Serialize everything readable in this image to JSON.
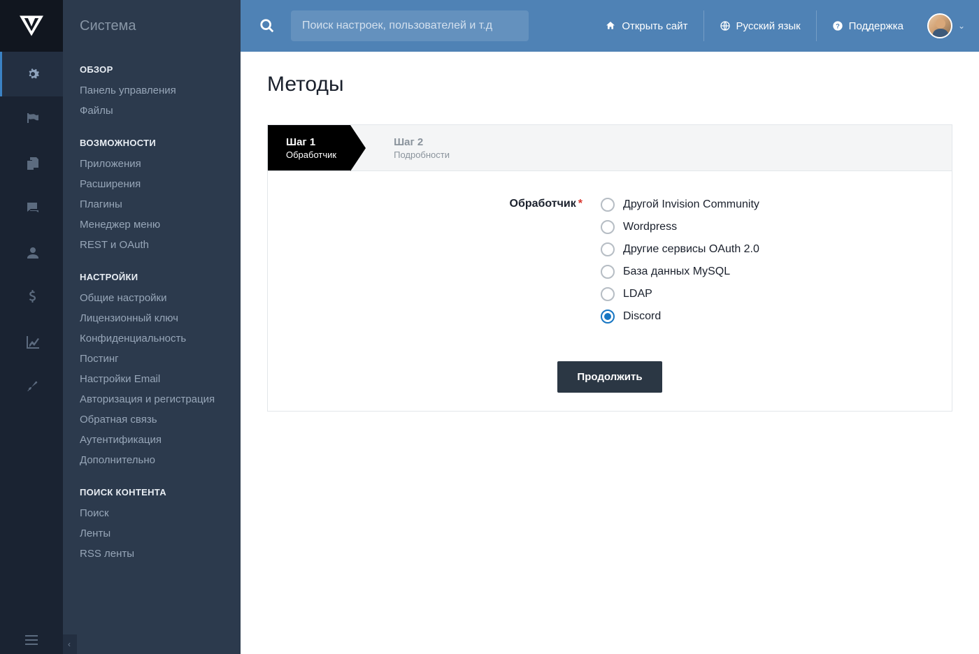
{
  "sidebar": {
    "title": "Система",
    "groups": [
      {
        "header": "ОБЗОР",
        "items": [
          "Панель управления",
          "Файлы"
        ]
      },
      {
        "header": "ВОЗМОЖНОСТИ",
        "items": [
          "Приложения",
          "Расширения",
          "Плагины",
          "Менеджер меню",
          "REST и OAuth"
        ]
      },
      {
        "header": "НАСТРОЙКИ",
        "items": [
          "Общие настройки",
          "Лицензионный ключ",
          "Конфиденциальность",
          "Постинг",
          "Настройки Email",
          "Авторизация и регистрация",
          "Обратная связь",
          "Аутентификация",
          "Дополнительно"
        ]
      },
      {
        "header": "ПОИСК КОНТЕНТА",
        "items": [
          "Поиск",
          "Ленты",
          "RSS ленты"
        ]
      }
    ]
  },
  "topbar": {
    "search_placeholder": "Поиск настроек, пользователей и т.д",
    "open_site": "Открыть сайт",
    "language": "Русский язык",
    "support": "Поддержка"
  },
  "page": {
    "title": "Методы"
  },
  "steps": {
    "s1_title": "Шаг 1",
    "s1_sub": "Обработчик",
    "s2_title": "Шаг 2",
    "s2_sub": "Подробности"
  },
  "form": {
    "handler_label": "Обработчик",
    "options": [
      "Другой Invision Community",
      "Wordpress",
      "Другие сервисы OAuth 2.0",
      "База данных MySQL",
      "LDAP",
      "Discord"
    ],
    "selected_index": 5,
    "submit": "Продолжить"
  }
}
